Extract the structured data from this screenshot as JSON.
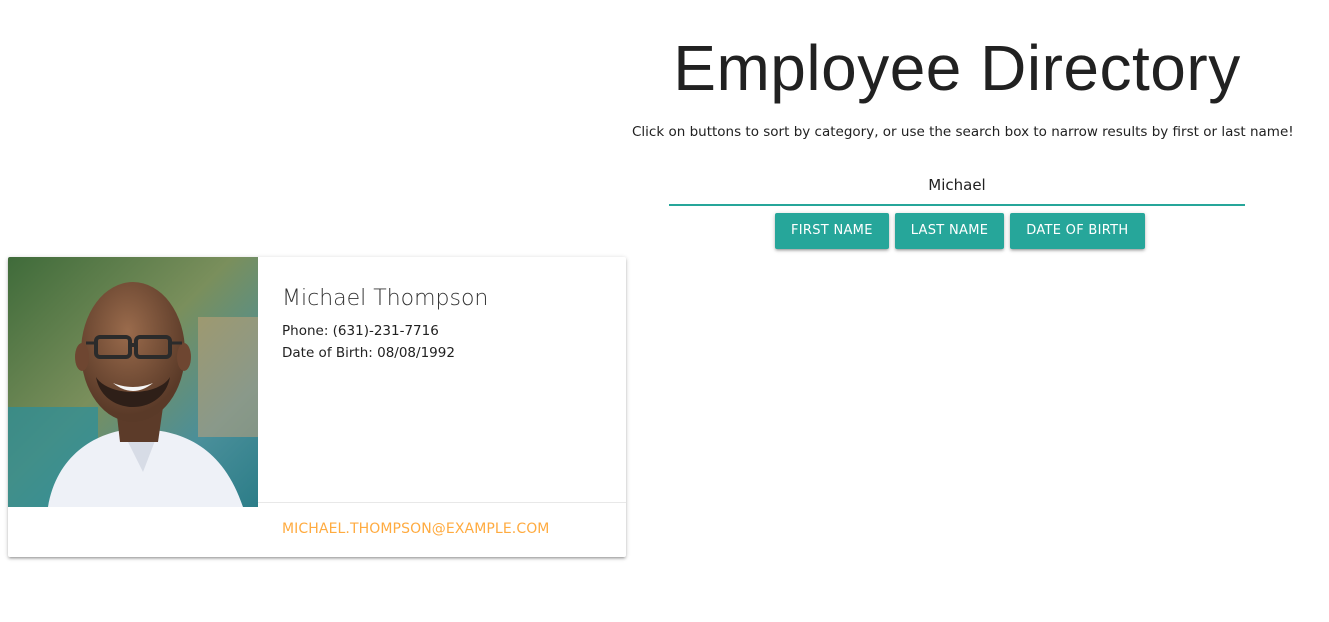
{
  "header": {
    "title": "Employee Directory",
    "subtitle": "Click on buttons to sort by category, or use the search box to narrow results by first or last name!"
  },
  "search": {
    "value": "Michael"
  },
  "sort_buttons": {
    "first_name": "FIRST NAME",
    "last_name": "LAST NAME",
    "date_of_birth": "DATE OF BIRTH"
  },
  "colors": {
    "accent": "#26a69a",
    "link": "#ffab40"
  },
  "employees": [
    {
      "name": "Michael Thompson",
      "phone_line": "Phone: (631)-231-7716",
      "dob_line": "Date of Birth: 08/08/1992",
      "email": "MICHAEL.THOMPSON@EXAMPLE.COM"
    }
  ]
}
